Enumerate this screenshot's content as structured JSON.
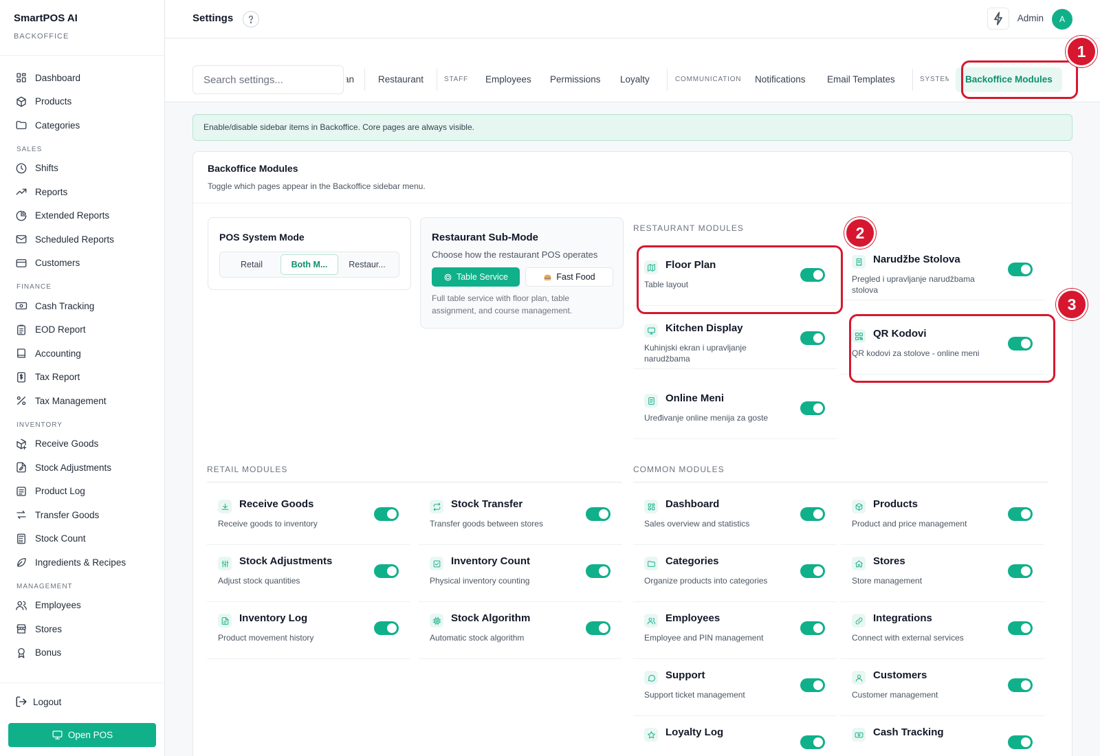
{
  "app": {
    "name": "SmartPOS AI",
    "subtitle": "BACKOFFICE"
  },
  "sidebar": {
    "items_top": [
      {
        "label": "Dashboard",
        "icon": "grid-icon"
      },
      {
        "label": "Products",
        "icon": "box-icon"
      },
      {
        "label": "Categories",
        "icon": "folder-icon"
      }
    ],
    "sales_label": "SALES",
    "sales": [
      {
        "label": "Shifts",
        "icon": "clock-icon"
      },
      {
        "label": "Reports",
        "icon": "trending-up-icon"
      },
      {
        "label": "Extended Reports",
        "icon": "pie-chart-icon"
      },
      {
        "label": "Scheduled Reports",
        "icon": "mail-icon"
      },
      {
        "label": "Customers",
        "icon": "credit-card-icon"
      }
    ],
    "finance_label": "FINANCE",
    "finance": [
      {
        "label": "Cash Tracking",
        "icon": "banknote-icon"
      },
      {
        "label": "EOD Report",
        "icon": "clipboard-icon"
      },
      {
        "label": "Accounting",
        "icon": "book-icon"
      },
      {
        "label": "Tax Report",
        "icon": "dollar-file-icon"
      },
      {
        "label": "Tax Management",
        "icon": "percent-icon"
      }
    ],
    "inventory_label": "INVENTORY",
    "inventory": [
      {
        "label": "Receive Goods",
        "icon": "package-plus-icon"
      },
      {
        "label": "Stock Adjustments",
        "icon": "file-edit-icon"
      },
      {
        "label": "Product Log",
        "icon": "list-icon"
      },
      {
        "label": "Transfer Goods",
        "icon": "arrows-icon"
      },
      {
        "label": "Stock Count",
        "icon": "calculator-icon"
      },
      {
        "label": "Ingredients & Recipes",
        "icon": "leaf-icon"
      }
    ],
    "management_label": "MANAGEMENT",
    "management": [
      {
        "label": "Employees",
        "icon": "users-icon"
      },
      {
        "label": "Stores",
        "icon": "store-icon"
      },
      {
        "label": "Bonus",
        "icon": "award-icon"
      }
    ],
    "logout": "Logout",
    "open_pos": "Open POS"
  },
  "header": {
    "title": "Settings",
    "user": "Admin",
    "avatar_initial": "A"
  },
  "search": {
    "placeholder": "Search settings..."
  },
  "tabs": {
    "partial_prev": "an",
    "restaurant": "Restaurant",
    "group_staff": "STAFF",
    "employees": "Employees",
    "permissions": "Permissions",
    "loyalty": "Loyalty",
    "group_communication": "COMMUNICATION",
    "notifications": "Notifications",
    "email_templates": "Email Templates",
    "group_system": "SYSTEM",
    "backoffice_modules": "Backoffice Modules"
  },
  "banner": "Enable/disable sidebar items in Backoffice. Core pages are always visible.",
  "card": {
    "title": "Backoffice Modules",
    "subtitle": "Toggle which pages appear in the Backoffice sidebar menu."
  },
  "pos_mode": {
    "title": "POS System Mode",
    "options": [
      "Retail",
      "Both M...",
      "Restaur..."
    ],
    "selected": "Both M..."
  },
  "sub_mode": {
    "title": "Restaurant Sub-Mode",
    "description": "Choose how the restaurant POS operates",
    "option_table": "Table Service",
    "option_fast": "Fast Food",
    "note": "Full table service with floor plan, table assignment, and course management."
  },
  "sections": {
    "restaurant": "RESTAURANT MODULES",
    "retail": "RETAIL MODULES",
    "common": "COMMON MODULES"
  },
  "restaurant_modules": [
    {
      "title": "Floor Plan",
      "desc": "Table layout",
      "icon": "map-icon",
      "enabled": true
    },
    {
      "title": "Narudžbe Stolova",
      "desc": "Pregled i upravljanje narudžbama stolova",
      "icon": "receipt-icon",
      "enabled": true
    },
    {
      "title": "Kitchen Display",
      "desc": "Kuhinjski ekran i upravljanje narudžbama",
      "icon": "monitor-icon",
      "enabled": true
    },
    {
      "title": "QR Kodovi",
      "desc": "QR kodovi za stolove - online meni",
      "icon": "qr-code-icon",
      "enabled": true
    },
    {
      "title": "Online Meni",
      "desc": "Uređivanje online menija za goste",
      "icon": "menu-doc-icon",
      "enabled": true
    }
  ],
  "retail_modules": [
    {
      "title": "Receive Goods",
      "desc": "Receive goods to inventory",
      "icon": "download-icon",
      "enabled": true
    },
    {
      "title": "Stock Transfer",
      "desc": "Transfer goods between stores",
      "icon": "repeat-icon",
      "enabled": true
    },
    {
      "title": "Stock Adjustments",
      "desc": "Adjust stock quantities",
      "icon": "sliders-icon",
      "enabled": true
    },
    {
      "title": "Inventory Count",
      "desc": "Physical inventory counting",
      "icon": "check-square-icon",
      "enabled": true
    },
    {
      "title": "Inventory Log",
      "desc": "Product movement history",
      "icon": "file-icon",
      "enabled": true
    },
    {
      "title": "Stock Algorithm",
      "desc": "Automatic stock algorithm",
      "icon": "cpu-icon",
      "enabled": true
    }
  ],
  "common_modules": [
    {
      "title": "Dashboard",
      "desc": "Sales overview and statistics",
      "icon": "grid-icon",
      "enabled": true
    },
    {
      "title": "Products",
      "desc": "Product and price management",
      "icon": "box-icon",
      "enabled": true
    },
    {
      "title": "Categories",
      "desc": "Organize products into categories",
      "icon": "folder-icon",
      "enabled": true
    },
    {
      "title": "Stores",
      "desc": "Store management",
      "icon": "home-icon",
      "enabled": true
    },
    {
      "title": "Employees",
      "desc": "Employee and PIN management",
      "icon": "users-icon",
      "enabled": true
    },
    {
      "title": "Integrations",
      "desc": "Connect with external services",
      "icon": "link-icon",
      "enabled": true
    },
    {
      "title": "Support",
      "desc": "Support ticket management",
      "icon": "message-icon",
      "enabled": true
    },
    {
      "title": "Customers",
      "desc": "Customer management",
      "icon": "user-icon",
      "enabled": true
    },
    {
      "title": "Loyalty Log",
      "desc": "",
      "icon": "star-icon",
      "enabled": true
    },
    {
      "title": "Cash Tracking",
      "desc": "",
      "icon": "banknote-icon",
      "enabled": true
    }
  ],
  "annotations": [
    "1",
    "2",
    "3"
  ],
  "colors": {
    "accent": "#10b08a",
    "highlight": "#d6172f"
  }
}
